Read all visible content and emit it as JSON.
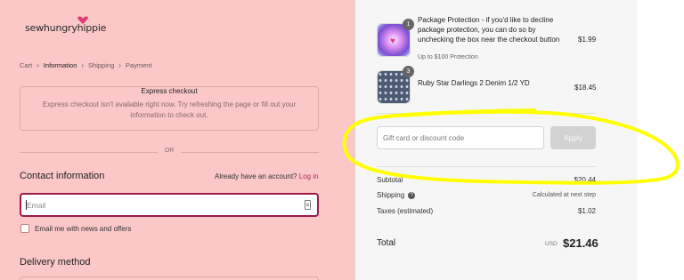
{
  "store": {
    "logo_text": "sewhungryhippie"
  },
  "breadcrumb": {
    "items": [
      "Cart",
      "Information",
      "Shipping",
      "Payment"
    ],
    "current": "Information",
    "separator": "›"
  },
  "express": {
    "title": "Express checkout",
    "message": "Express checkout isn't available right now. Try refreshing the page or fill out your information to check out."
  },
  "divider_text": "OR",
  "contact": {
    "heading": "Contact information",
    "account_prompt": "Already have an account?",
    "login_label": "Log in",
    "email_placeholder": "Email",
    "newsletter_label": "Email me with news and offers"
  },
  "delivery": {
    "heading": "Delivery method"
  },
  "order": {
    "items": [
      {
        "title": "Package Protection - if you'd like to decline package protection, you can do so by unchecking the box near the checkout button",
        "subtitle": "Up to $100 Protection",
        "price": "$1.99",
        "quantity": "1",
        "image_icon": "heart-icon"
      },
      {
        "title": "Ruby Star Darlings 2 Denim 1/2 YD",
        "price": "$18.45",
        "quantity": "3",
        "image_icon": "fabric-swatch"
      }
    ],
    "discount": {
      "placeholder": "Gift card or discount code",
      "apply_label": "Apply"
    },
    "summary": {
      "subtotal_label": "Subtotal",
      "subtotal_value": "$20.44",
      "shipping_label": "Shipping",
      "shipping_value": "Calculated at next step",
      "taxes_label": "Taxes (estimated)",
      "taxes_value": "$1.02",
      "total_label": "Total",
      "total_currency": "USD",
      "total_value": "$21.46"
    }
  },
  "colors": {
    "left_background": "#fbc7c7",
    "accent": "#9b1c4a",
    "link": "#b5285a",
    "highlight_annotation": "#ffff00"
  }
}
